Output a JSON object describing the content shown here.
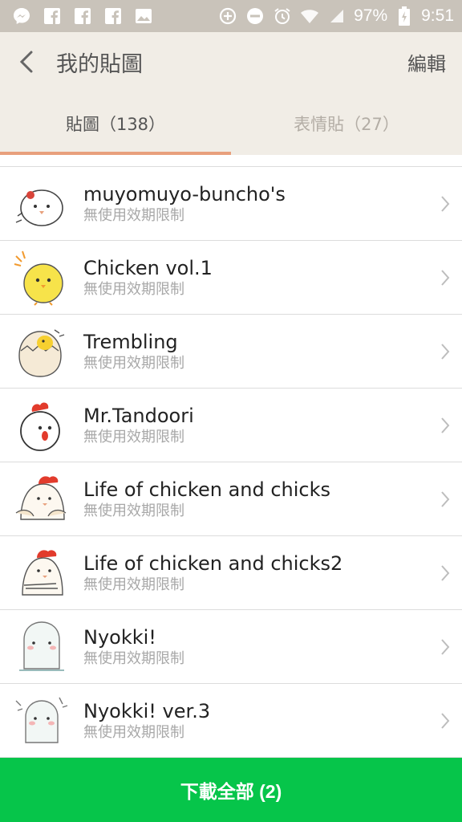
{
  "status_bar": {
    "left_icons": [
      "messenger-icon",
      "facebook-icon",
      "facebook-icon",
      "facebook-icon",
      "gallery-icon"
    ],
    "right_icons": [
      "data-saver-icon",
      "dnd-icon",
      "alarm-icon",
      "wifi-icon",
      "signal-icon",
      "battery-icon"
    ],
    "battery": "97%",
    "time": "9:51"
  },
  "header": {
    "title": "我的貼圖",
    "edit_label": "編輯"
  },
  "tabs": [
    {
      "label": "貼圖（138）",
      "active": true
    },
    {
      "label": "表情貼（27）",
      "active": false
    }
  ],
  "items": [
    {
      "name": "muyomuyo-buncho's",
      "sub": "無使用效期限制"
    },
    {
      "name": "Chicken vol.1",
      "sub": "無使用效期限制"
    },
    {
      "name": "Trembling",
      "sub": "無使用效期限制"
    },
    {
      "name": "Mr.Tandoori",
      "sub": "無使用效期限制"
    },
    {
      "name": "Life of chicken and chicks",
      "sub": "無使用效期限制"
    },
    {
      "name": "Life of chicken and chicks2",
      "sub": "無使用效期限制"
    },
    {
      "name": "Nyokki!",
      "sub": "無使用效期限制"
    },
    {
      "name": "Nyokki! ver.3",
      "sub": "無使用效期限制"
    }
  ],
  "download_button": "下載全部 (2)",
  "colors": {
    "accent_green": "#06c54a",
    "tab_underline": "#e8a07c",
    "header_bg": "#f1ede6"
  }
}
